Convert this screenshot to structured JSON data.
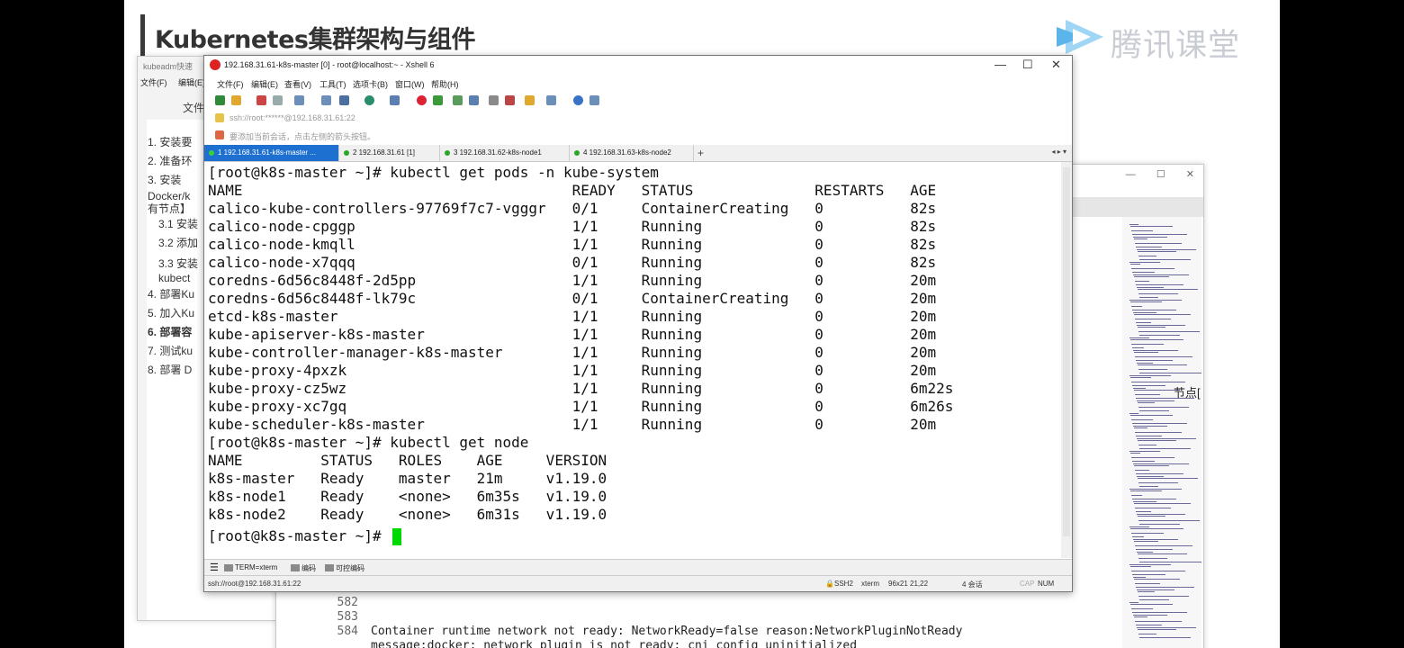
{
  "slide": {
    "title": "Kubernetes集群架构与组件",
    "logo_text": "腾讯课堂",
    "logo_icon": "play-triangle-icon"
  },
  "doc_window": {
    "title": "kubeadm快速",
    "menu": [
      "文件(F)",
      "编辑(E)"
    ],
    "file_label": "文件",
    "toc": [
      {
        "text": "1. 安装要",
        "sub": false,
        "bold": false
      },
      {
        "text": "2. 准备环",
        "sub": false,
        "bold": false
      },
      {
        "text": "3. 安装",
        "sub": false,
        "bold": false
      },
      {
        "text": "Docker/k",
        "sub": false,
        "bold": false
      },
      {
        "text": "有节点】",
        "sub": false,
        "bold": false
      },
      {
        "text": "3.1 安装",
        "sub": true,
        "bold": false
      },
      {
        "text": "3.2 添加",
        "sub": true,
        "bold": false
      },
      {
        "text": "3.3 安装",
        "sub": true,
        "bold": false
      },
      {
        "text": "kubect",
        "sub": true,
        "bold": false
      },
      {
        "text": "4. 部署Ku",
        "sub": false,
        "bold": false
      },
      {
        "text": "5. 加入Ku",
        "sub": false,
        "bold": false
      },
      {
        "text": "6. 部署容",
        "sub": false,
        "bold": true
      },
      {
        "text": "7. 测试ku",
        "sub": false,
        "bold": false
      },
      {
        "text": "8. 部署 D",
        "sub": false,
        "bold": false
      }
    ]
  },
  "code_window": {
    "controls": [
      "—",
      "☐",
      "✕"
    ],
    "cut_text": "节点[",
    "lines": [
      {
        "num": "582",
        "text": ""
      },
      {
        "num": "583",
        "text": ""
      },
      {
        "num": "584",
        "text": "Container runtime network not ready: NetworkReady=false reason:NetworkPluginNotReady"
      },
      {
        "num": "",
        "text": "message:docker: network plugin is not ready: cni config uninitialized"
      }
    ]
  },
  "xshell": {
    "title": "192.168.31.61-k8s-master [0] - root@localhost:~ - Xshell 6",
    "window_controls": {
      "minimize": "—",
      "maximize": "☐",
      "close": "✕"
    },
    "menu": [
      "文件(F)",
      "编辑(E)",
      "查看(V)",
      "工具(T)",
      "选项卡(B)",
      "窗口(W)",
      "帮助(H)"
    ],
    "address": "ssh://root:******@192.168.31.61:22",
    "hint": "要添加当前会话，点击左侧的箭头按钮。",
    "tabs": [
      {
        "label": "1 192.168.31.61-k8s-master ...",
        "active": true
      },
      {
        "label": "2 192.168.31.61 [1]",
        "active": false
      },
      {
        "label": "3 192.168.31.62-k8s-node1",
        "active": false
      },
      {
        "label": "4 192.168.31.63-k8s-node2",
        "active": false
      }
    ],
    "tab_add": "+",
    "tab_nav": "◂ ▸ ▾",
    "terminal_lines": [
      "[root@k8s-master ~]# kubectl get pods -n kube-system",
      "NAME                                      READY   STATUS              RESTARTS   AGE",
      "calico-kube-controllers-97769f7c7-vgggr   0/1     ContainerCreating   0          82s",
      "calico-node-cpggp                         1/1     Running             0          82s",
      "calico-node-kmqll                         1/1     Running             0          82s",
      "calico-node-x7qqq                         0/1     Running             0          82s",
      "coredns-6d56c8448f-2d5pp                  1/1     Running             0          20m",
      "coredns-6d56c8448f-lk79c                  0/1     ContainerCreating   0          20m",
      "etcd-k8s-master                           1/1     Running             0          20m",
      "kube-apiserver-k8s-master                 1/1     Running             0          20m",
      "kube-controller-manager-k8s-master        1/1     Running             0          20m",
      "kube-proxy-4pxzk                          1/1     Running             0          20m",
      "kube-proxy-cz5wz                          1/1     Running             0          6m22s",
      "kube-proxy-xc7gq                          1/1     Running             0          6m26s",
      "kube-scheduler-k8s-master                 1/1     Running             0          20m",
      "[root@k8s-master ~]# kubectl get node",
      "NAME         STATUS   ROLES    AGE     VERSION",
      "k8s-master   Ready    master   21m     v1.19.0",
      "k8s-node1    Ready    <none>   6m35s   v1.19.0",
      "k8s-node2    Ready    <none>   6m31s   v1.19.0",
      "[root@k8s-master ~]# "
    ],
    "cursor_color": "#00d800",
    "bottom_bar": {
      "term": "TERM=xterm",
      "encoding": "编码",
      "controllable": "可控编码"
    },
    "status": {
      "conn": "ssh://root@192.168.31.61:22",
      "protocol": "SSH2",
      "terminal": "xterm",
      "size": "96x21",
      "cursor_pos": "21,22",
      "sessions": "4 会话",
      "cap": "CAP",
      "num": "NUM"
    },
    "colors": {
      "active_tab": "#1d6fd0",
      "close_icon": "#d22"
    }
  }
}
